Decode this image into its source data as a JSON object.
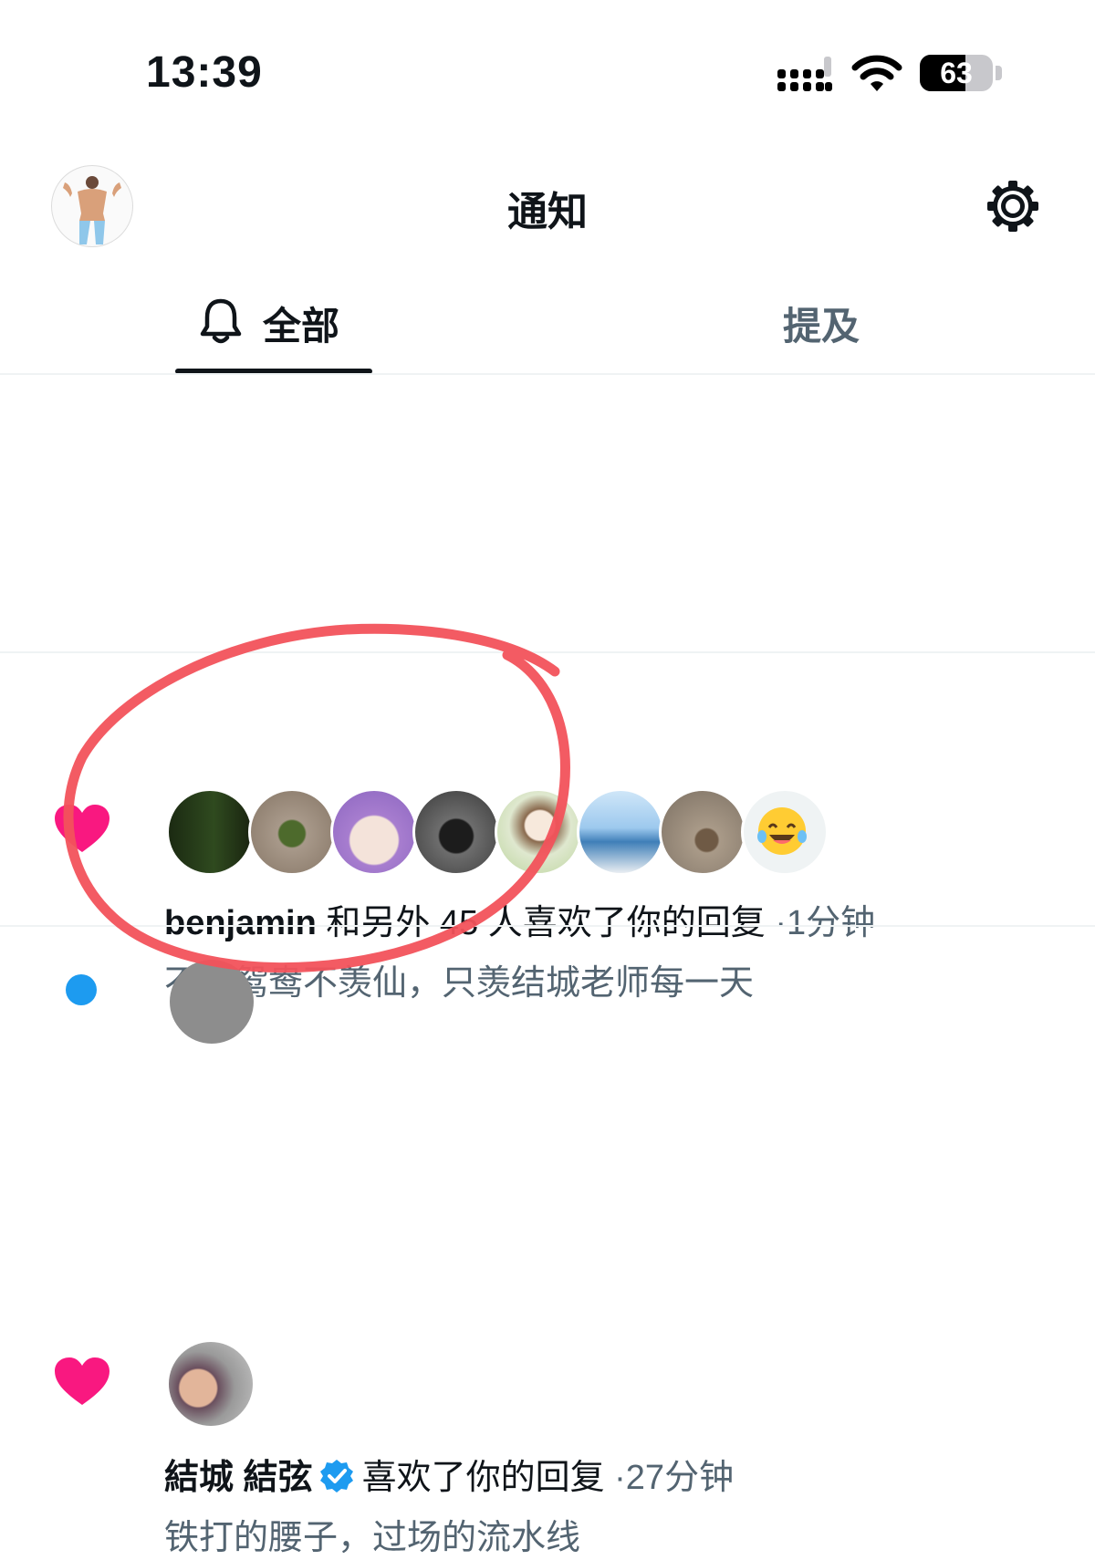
{
  "status_bar": {
    "time": "13:39",
    "battery_level": "63",
    "battery_fraction": 0.63
  },
  "header": {
    "title": "通知"
  },
  "tabs": [
    {
      "label": "全部",
      "selected": true
    },
    {
      "label": "提及",
      "selected": false
    }
  ],
  "notifications": [
    {
      "type": "like",
      "user": "benjamin",
      "action": "和另外 45 人喜欢了你的回复",
      "time": "·1分钟",
      "text": "不羡鸳鸯不羡仙，只羡结城老师每一天",
      "avatar_count": 8
    },
    {
      "type": "like",
      "user": "結城 結弦",
      "verified": true,
      "action": "喜欢了你的回复",
      "time": "·27分钟",
      "text": "铁打的腰子，过场的流水线"
    }
  ],
  "colors": {
    "like": "#f91880",
    "verified": "#1d9bf0",
    "annotation": "#f2525b",
    "secondary_text": "#536471",
    "primary_text": "#0f1419"
  },
  "icons": {
    "signal": "signal-icon",
    "wifi": "wifi-icon",
    "battery": "battery-icon",
    "settings": "gear-icon",
    "tab_all": "bell-icon",
    "like": "heart-icon",
    "verified": "verified-badge-icon"
  }
}
